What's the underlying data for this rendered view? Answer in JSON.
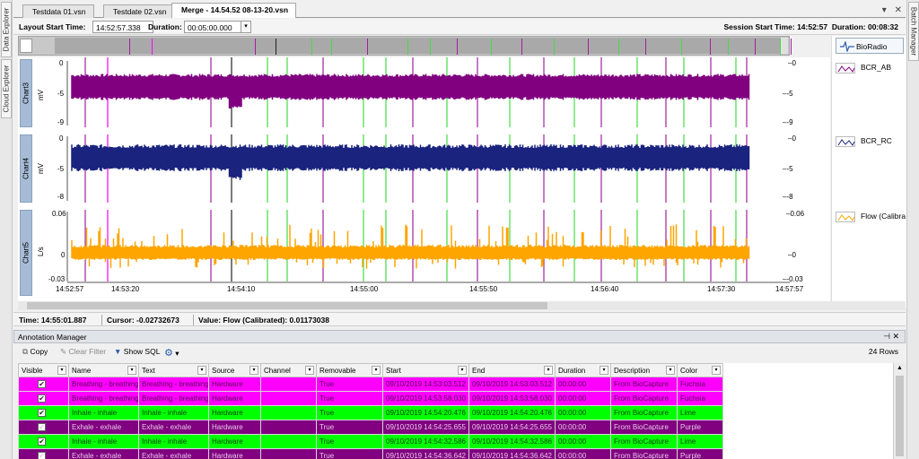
{
  "sidebar_left": {
    "data_explorer": "Data Explorer",
    "cloud_explorer": "Cloud Explorer"
  },
  "sidebar_right": {
    "batch_manager": "Batch Manager"
  },
  "tabs": [
    {
      "label": "Testdata 01.vsn"
    },
    {
      "label": "Testdate 02.vsn"
    },
    {
      "label": "Merge - 14.54.52 08-13-20.vsn"
    }
  ],
  "tab_tools": {
    "dropdown": "▾",
    "close": "✕"
  },
  "layout": {
    "start_label": "Layout Start Time:",
    "start_value": "14:52:57.338",
    "duration_label": "Duration:",
    "duration_value": "00:05:00.000",
    "session_label": "Session Start Time: 14:52:57",
    "session_duration": "Duration: 00:08:32"
  },
  "charts": [
    {
      "name": "Chart3",
      "unit": "mV",
      "y_ticks": [
        "0",
        "-5",
        "-9"
      ],
      "right_ticks": [
        "0",
        "5",
        "9"
      ],
      "color": "#800080"
    },
    {
      "name": "Chart4",
      "unit": "mV",
      "y_ticks": [
        "0",
        "-5",
        "-8"
      ],
      "right_ticks": [
        "0",
        "5",
        "8"
      ],
      "color": "#1a237e"
    },
    {
      "name": "Chart5",
      "unit": "L/s",
      "y_ticks": [
        "0.06",
        "0",
        "-0.03"
      ],
      "right_ticks": [
        "0.06",
        "0",
        "0.03"
      ],
      "color": "#ffa500"
    }
  ],
  "time_axis": [
    "14:52:57",
    "14:53:20",
    "14:54:10",
    "14:55:00",
    "14:55:50",
    "14:56:40",
    "14:57:30",
    "14:57:57"
  ],
  "legend": {
    "title": "BioRadio",
    "items": [
      {
        "label": "BCR_AB",
        "color": "#800080"
      },
      {
        "label": "BCR_RC",
        "color": "#1a237e"
      },
      {
        "label": "Flow (Calibra",
        "color": "#ffa500"
      }
    ]
  },
  "status": {
    "time": "Time: 14:55:01.887",
    "cursor": "Cursor: -0.02732673",
    "value": "Value: Flow (Calibrated): 0.01173038"
  },
  "annotation_manager": {
    "title": "Annotation Manager",
    "pin": "⊣ ✕",
    "toolbar": {
      "copy": "Copy",
      "clear_filter": "Clear Filter",
      "show_sql": "Show SQL",
      "rows": "24 Rows"
    },
    "columns": [
      "Visible",
      "Name",
      "Text",
      "Source",
      "Channel",
      "Removable",
      "Start",
      "End",
      "Duration",
      "Description",
      "Color"
    ],
    "rows": [
      {
        "checked": "✔",
        "name": "Breathing - breathing",
        "text": "Breathing - breathing",
        "source": "Hardware",
        "channel": "",
        "removable": "True",
        "start": "09/10/2019 14:53:03.512",
        "end": "09/10/2019 14:53:03.512",
        "duration": "00:00:00",
        "description": "From BioCapture",
        "color": "Fuchsia",
        "bg": "#ff00ff",
        "fg": "#550055"
      },
      {
        "checked": "✔",
        "name": "Breathing - breathing",
        "text": "Breathing - breathing",
        "source": "Hardware",
        "channel": "",
        "removable": "True",
        "start": "09/10/2019 14:53:58.030",
        "end": "09/10/2019 14:53:58.030",
        "duration": "00:00:00",
        "description": "From BioCapture",
        "color": "Fuchsia",
        "bg": "#ff00ff",
        "fg": "#550055"
      },
      {
        "checked": "✔",
        "name": "Inhale - inhale",
        "text": "Inhale - inhale",
        "source": "Hardware",
        "channel": "",
        "removable": "True",
        "start": "09/10/2019 14:54:20.476",
        "end": "09/10/2019 14:54:20.476",
        "duration": "00:00:00",
        "description": "From BioCapture",
        "color": "Lime",
        "bg": "#00ff00",
        "fg": "#004400"
      },
      {
        "checked": "✔",
        "name": "Exhale - exhale",
        "text": "Exhale - exhale",
        "source": "Hardware",
        "channel": "",
        "removable": "True",
        "start": "09/10/2019 14:54:25.655",
        "end": "09/10/2019 14:54:25.655",
        "duration": "00:00:00",
        "description": "From BioCapture",
        "color": "Purple",
        "bg": "#800080",
        "fg": "#e8c8e8"
      },
      {
        "checked": "✔",
        "name": "Inhale - inhale",
        "text": "Inhale - inhale",
        "source": "Hardware",
        "channel": "",
        "removable": "True",
        "start": "09/10/2019 14:54:32.586",
        "end": "09/10/2019 14:54:32.586",
        "duration": "00:00:00",
        "description": "From BioCapture",
        "color": "Lime",
        "bg": "#00ff00",
        "fg": "#004400"
      },
      {
        "checked": "✔",
        "name": "Exhale - exhale",
        "text": "Exhale - exhale",
        "source": "Hardware",
        "channel": "",
        "removable": "True",
        "start": "09/10/2019 14:54:36.642",
        "end": "09/10/2019 14:54:36.642",
        "duration": "00:00:00",
        "description": "From BioCapture",
        "color": "Purple",
        "bg": "#800080",
        "fg": "#e8c8e8"
      }
    ]
  },
  "marker_colors": {
    "fuchsia": "#ff00ff",
    "lime": "#44dd44",
    "purple": "#a020a0",
    "cursor": "#222222"
  }
}
